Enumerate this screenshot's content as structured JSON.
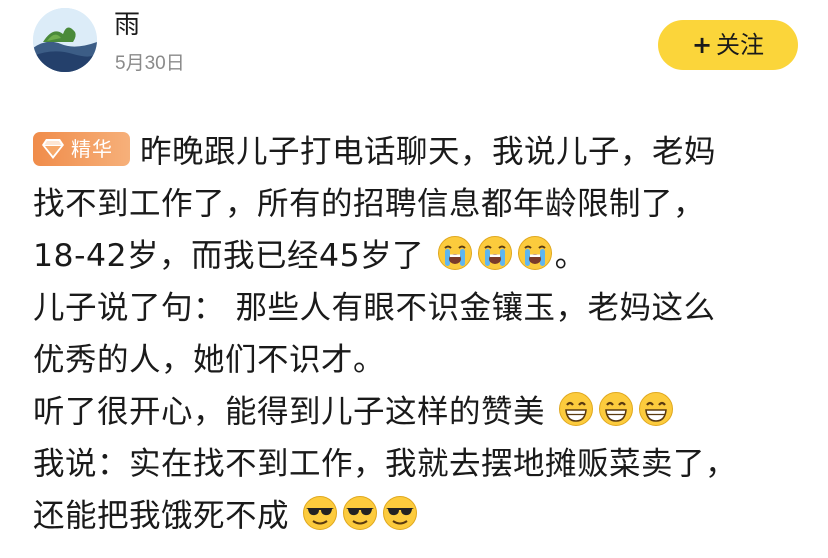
{
  "header": {
    "author": "雨",
    "date": "5月30日",
    "follow_label": "关注"
  },
  "post": {
    "badge": "精华",
    "lines": {
      "l1": "昨晚跟儿子打电话聊天，我说儿子，老妈",
      "l2": "找不到工作了，所有的招聘信息都年龄限制了，",
      "l3a": "18-42岁，而我已经45岁了",
      "l3b": "。",
      "l4": "儿子说了句： 那些人有眼不识金镶玉，老妈这么",
      "l5": "优秀的人，她们不识才。",
      "l6": "听了很开心，能得到儿子这样的赞美",
      "l7": "我说：实在找不到工作，我就去摆地摊贩菜卖了，",
      "l8": "还能把我饿死不成"
    }
  },
  "icons": {
    "avatar": "landscape-avatar",
    "badge_icon": "diamond-icon",
    "cry": "loudly-crying-face-icon",
    "grin": "grinning-face-icon",
    "cool": "sunglasses-face-icon"
  },
  "colors": {
    "follow_bg": "#fbd53a",
    "badge_bg": "#f08c4a",
    "date": "#8a8a8a"
  }
}
